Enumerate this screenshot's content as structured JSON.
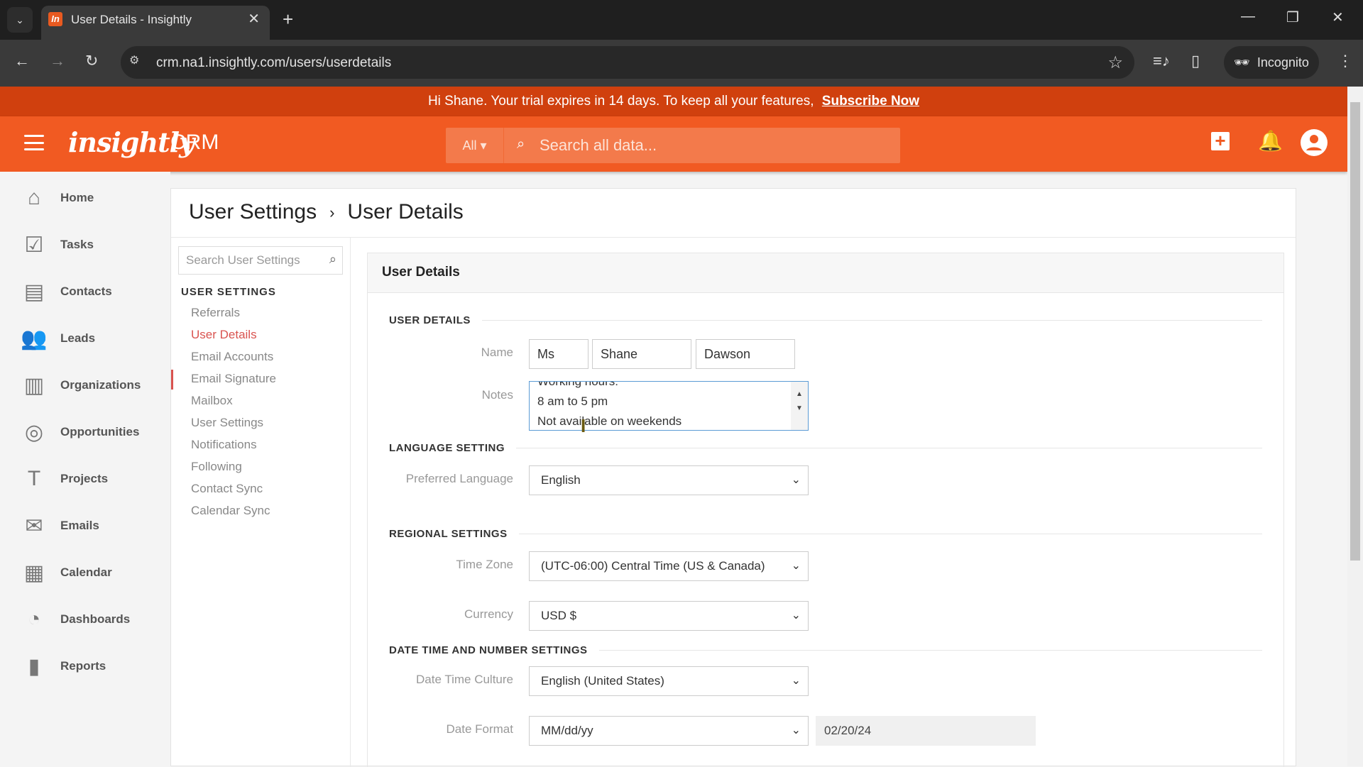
{
  "browser": {
    "tab_title": "User Details - Insightly",
    "favicon": "In",
    "url": "crm.na1.insightly.com/users/userdetails",
    "profile_label": "Incognito"
  },
  "banner": {
    "text": "Hi Shane. Your trial expires in 14 days. To keep all your features,",
    "link": "Subscribe Now"
  },
  "appbar": {
    "logo": "insightly",
    "product": "CRM",
    "search_scope": "All ▾",
    "search_placeholder": "Search all data..."
  },
  "sidebar": {
    "items": [
      {
        "label": "Home",
        "icon": "home-icon"
      },
      {
        "label": "Tasks",
        "icon": "tasks-icon"
      },
      {
        "label": "Contacts",
        "icon": "contacts-icon"
      },
      {
        "label": "Leads",
        "icon": "leads-icon"
      },
      {
        "label": "Organizations",
        "icon": "organizations-icon"
      },
      {
        "label": "Opportunities",
        "icon": "opportunities-icon"
      },
      {
        "label": "Projects",
        "icon": "projects-icon"
      },
      {
        "label": "Emails",
        "icon": "emails-icon"
      },
      {
        "label": "Calendar",
        "icon": "calendar-icon"
      },
      {
        "label": "Dashboards",
        "icon": "dashboards-icon"
      },
      {
        "label": "Reports",
        "icon": "reports-icon"
      }
    ]
  },
  "breadcrumb": {
    "parent": "User Settings",
    "separator": "›",
    "current": "User Details"
  },
  "subnav": {
    "search_placeholder": "Search User Settings",
    "heading": "USER SETTINGS",
    "items": [
      "Referrals",
      "User Details",
      "Email Accounts",
      "Email Signature",
      "Mailbox",
      "User Settings",
      "Notifications",
      "Following",
      "Contact Sync",
      "Calendar Sync"
    ],
    "active": "User Details"
  },
  "panel": {
    "title": "User Details",
    "sections": {
      "user_details": "USER DETAILS",
      "language": "LANGUAGE SETTING",
      "regional": "REGIONAL SETTINGS",
      "datetime": "DATE TIME AND NUMBER SETTINGS"
    },
    "labels": {
      "name": "Name",
      "notes": "Notes",
      "language": "Preferred Language",
      "timezone": "Time Zone",
      "currency": "Currency",
      "culture": "Date Time Culture",
      "date_format": "Date Format"
    },
    "values": {
      "salutation": "Ms",
      "first_name": "Shane",
      "last_name": "Dawson",
      "notes_lines": [
        "Working hours:",
        "8 am to 5 pm",
        "Not available on weekends"
      ],
      "language": "English",
      "timezone": "(UTC-06:00) Central Time (US & Canada)",
      "currency": "USD $",
      "culture": "English (United States)",
      "date_format": "MM/dd/yy",
      "date_sample": "02/20/24"
    }
  }
}
